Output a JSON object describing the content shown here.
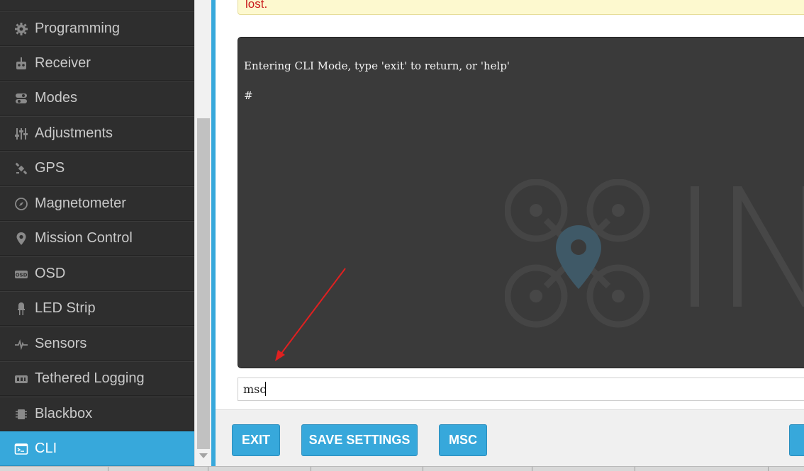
{
  "sidebar": {
    "items": [
      {
        "label": "Programming",
        "icon": "gear-icon"
      },
      {
        "label": "Receiver",
        "icon": "receiver-icon"
      },
      {
        "label": "Modes",
        "icon": "toggle-icon"
      },
      {
        "label": "Adjustments",
        "icon": "sliders-icon"
      },
      {
        "label": "GPS",
        "icon": "satellite-icon"
      },
      {
        "label": "Magnetometer",
        "icon": "compass-icon"
      },
      {
        "label": "Mission Control",
        "icon": "map-pin-icon"
      },
      {
        "label": "OSD",
        "icon": "osd-icon"
      },
      {
        "label": "LED Strip",
        "icon": "led-icon"
      },
      {
        "label": "Sensors",
        "icon": "pulse-icon"
      },
      {
        "label": "Tethered Logging",
        "icon": "logging-icon"
      },
      {
        "label": "Blackbox",
        "icon": "blackbox-icon"
      },
      {
        "label": "CLI",
        "icon": "terminal-icon",
        "active": true
      }
    ]
  },
  "warning": {
    "text": "lost."
  },
  "console": {
    "line1": "Entering CLI Mode, type 'exit' to return, or 'help'",
    "line2": "",
    "line3": "#"
  },
  "cli_input": {
    "value": "msc"
  },
  "footer": {
    "exit_label": "EXIT",
    "save_label": "SAVE SETTINGS",
    "msc_label": "MSC"
  },
  "colors": {
    "accent": "#37a8db",
    "sidebar_bg": "#2e2e2e",
    "console_bg": "#3a3a3a",
    "annotation_arrow": "#e02020"
  }
}
